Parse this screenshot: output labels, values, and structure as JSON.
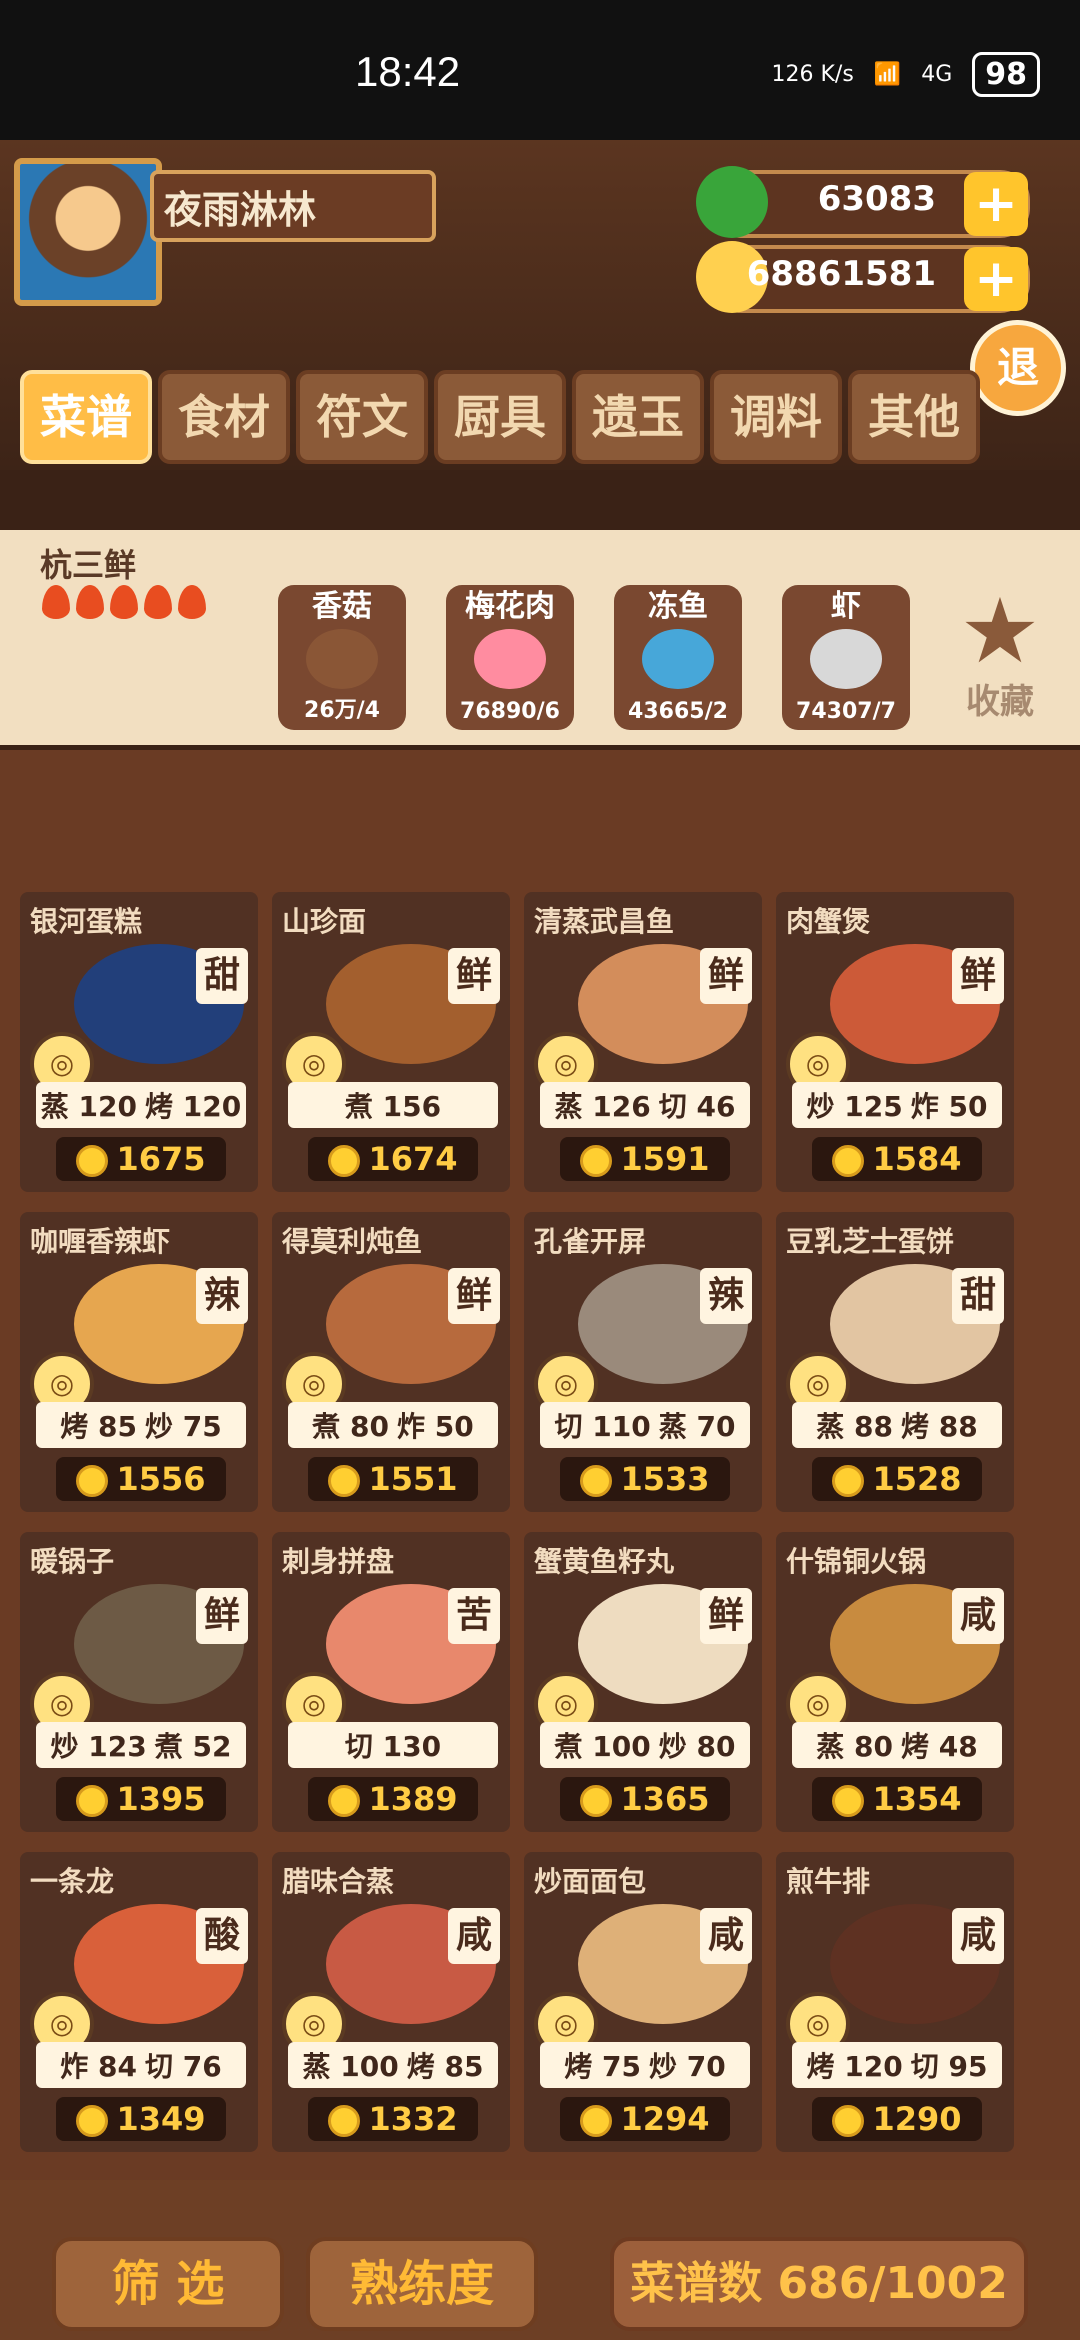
{
  "status": {
    "time": "18:42",
    "network": "126 K/s",
    "signal": "4G",
    "battery": "98"
  },
  "player": {
    "name": "夜雨淋林"
  },
  "currency": {
    "jade": "63083",
    "coins": "68861581"
  },
  "exit_label": "退",
  "tabs": [
    "菜谱",
    "食材",
    "符文",
    "厨具",
    "遗玉",
    "调料",
    "其他"
  ],
  "recipe": {
    "title": "杭三鲜",
    "stars": 5,
    "ingredients": [
      {
        "name": "香菇",
        "count": "26万/4"
      },
      {
        "name": "梅花肉",
        "count": "76890/6"
      },
      {
        "name": "冻鱼",
        "count": "43665/2"
      },
      {
        "name": "虾",
        "count": "74307/7"
      }
    ],
    "favorite": "收藏"
  },
  "cards": [
    {
      "name": "银河蛋糕",
      "taste": "甜",
      "skills": [
        "蒸 120",
        "烤 120"
      ],
      "price": "1675"
    },
    {
      "name": "山珍面",
      "taste": "鲜",
      "skills": [
        "煮 156"
      ],
      "price": "1674"
    },
    {
      "name": "清蒸武昌鱼",
      "taste": "鲜",
      "skills": [
        "蒸 126",
        "切 46"
      ],
      "price": "1591"
    },
    {
      "name": "肉蟹煲",
      "taste": "鲜",
      "skills": [
        "炒 125",
        "炸 50"
      ],
      "price": "1584"
    },
    {
      "name": "咖喱香辣虾",
      "taste": "辣",
      "skills": [
        "烤 85",
        "炒 75"
      ],
      "price": "1556"
    },
    {
      "name": "得莫利炖鱼",
      "taste": "鲜",
      "skills": [
        "煮 80",
        "炸 50"
      ],
      "price": "1551"
    },
    {
      "name": "孔雀开屏",
      "taste": "辣",
      "skills": [
        "切 110",
        "蒸 70"
      ],
      "price": "1533"
    },
    {
      "name": "豆乳芝士蛋饼",
      "taste": "甜",
      "skills": [
        "蒸 88",
        "烤 88"
      ],
      "price": "1528"
    },
    {
      "name": "暖锅子",
      "taste": "鲜",
      "skills": [
        "炒 123",
        "煮 52"
      ],
      "price": "1395"
    },
    {
      "name": "刺身拼盘",
      "taste": "苦",
      "skills": [
        "切 130"
      ],
      "price": "1389"
    },
    {
      "name": "蟹黄鱼籽丸",
      "taste": "鲜",
      "skills": [
        "煮 100",
        "炒 80"
      ],
      "price": "1365"
    },
    {
      "name": "什锦铜火锅",
      "taste": "咸",
      "skills": [
        "蒸 80",
        "烤 48"
      ],
      "price": "1354"
    },
    {
      "name": "一条龙",
      "taste": "酸",
      "skills": [
        "炸 84",
        "切 76"
      ],
      "price": "1349"
    },
    {
      "name": "腊味合蒸",
      "taste": "咸",
      "skills": [
        "蒸 100",
        "烤 85"
      ],
      "price": "1332"
    },
    {
      "name": "炒面面包",
      "taste": "咸",
      "skills": [
        "烤 75",
        "炒 70"
      ],
      "price": "1294"
    },
    {
      "name": "煎牛排",
      "taste": "咸",
      "skills": [
        "烤 120",
        "切 95"
      ],
      "price": "1290"
    }
  ],
  "bottom": {
    "filter": "筛 选",
    "proficiency": "熟练度",
    "recipe_count": "菜谱数 686/1002"
  }
}
